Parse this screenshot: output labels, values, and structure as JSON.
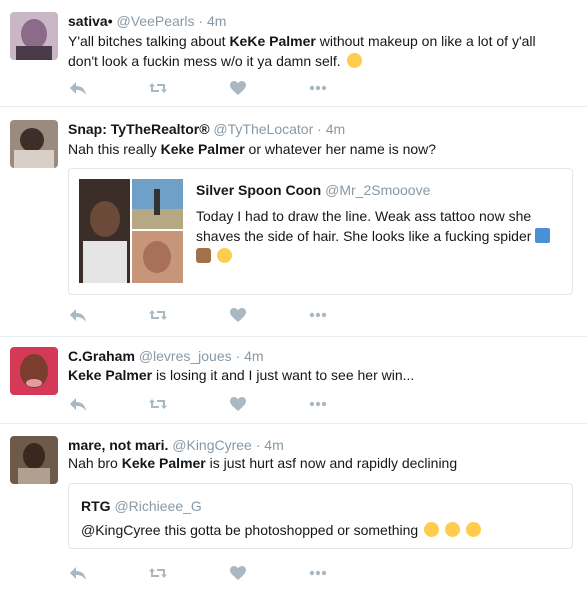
{
  "tweets": [
    {
      "name": "sativa•",
      "handle": "@VeePearls",
      "dot": "·",
      "time": "4m",
      "text_pre": "Y'all bitches talking about ",
      "text_kw": "KeKe Palmer",
      "text_post": " without makeup  on like a lot of y'all don't look a fuckin mess w/o it ya damn self."
    },
    {
      "name": "Snap: TyTheRealtor®",
      "handle": "@TyTheLocator",
      "dot": "·",
      "time": "4m",
      "text_pre": "Nah this really ",
      "text_kw": "Keke Palmer",
      "text_post": " or whatever her name is now?",
      "quote": {
        "name": "Silver Spoon Coon",
        "handle": "@Mr_2Smooove",
        "text": "Today I had to draw the line. Weak ass tattoo now she shaves the side of hair. She looks like a fucking spider"
      }
    },
    {
      "name": "C.Graham",
      "handle": "@levres_joues",
      "dot": "·",
      "time": "4m",
      "text_pre": "",
      "text_kw": "Keke Palmer",
      "text_post": " is losing it and I just want to see her win..."
    },
    {
      "name": "mare, not mari.",
      "handle": "@KingCyree",
      "dot": "·",
      "time": "4m",
      "text_pre": "Nah bro ",
      "text_kw": "Keke Palmer",
      "text_post": " is just hurt asf now and rapidly declining",
      "quote": {
        "name": "RTG",
        "handle": "@Richieee_G",
        "text": "@KingCyree this gotta be photoshopped or something"
      }
    }
  ],
  "colors": {
    "text": "#14171a",
    "muted": "#8899a6",
    "icon": "#aab8c2",
    "border": "#e6ecf0"
  },
  "icons": [
    "reply-icon",
    "retweet-icon",
    "like-icon",
    "more-icon"
  ]
}
